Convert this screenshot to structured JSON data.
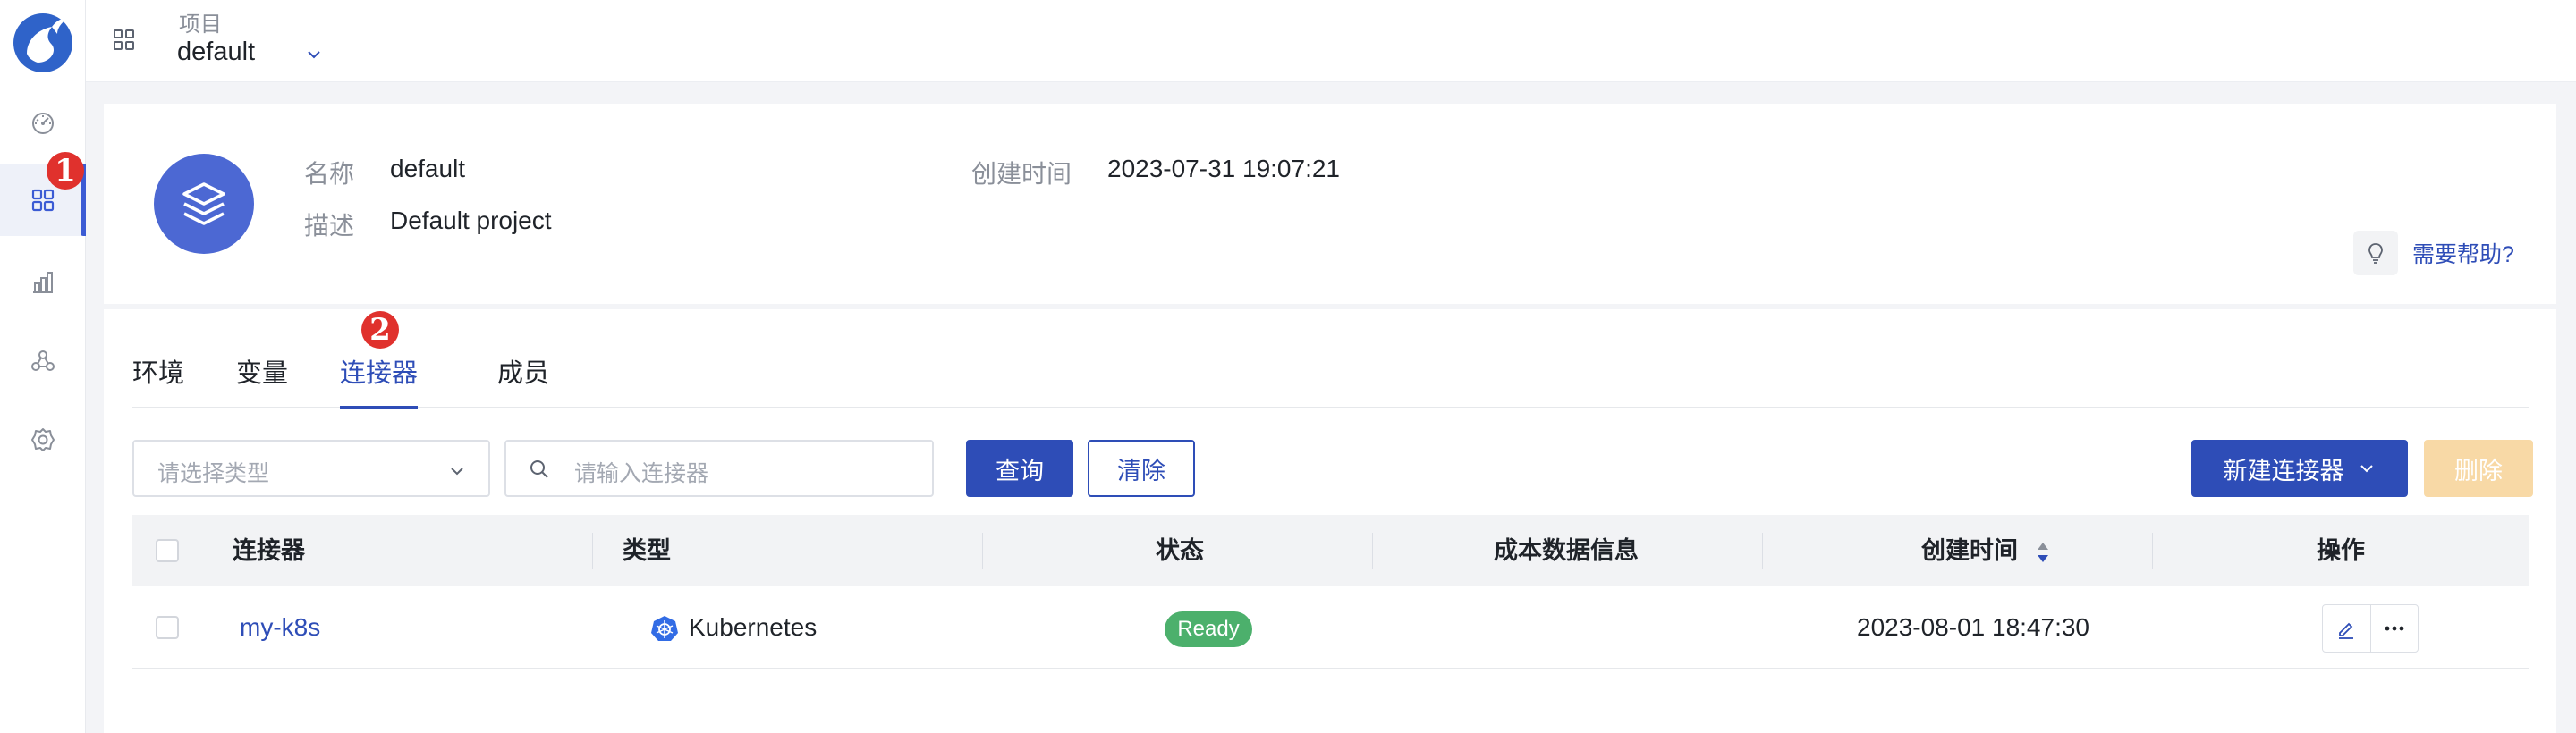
{
  "topbar": {
    "project_label": "项目",
    "project_value": "default"
  },
  "badges": {
    "one": "1",
    "two": "2"
  },
  "info": {
    "name_label": "名称",
    "name_value": "default",
    "desc_label": "描述",
    "desc_value": "Default project",
    "created_label": "创建时间",
    "created_value": "2023-07-31 19:07:21",
    "help_text": "需要帮助?"
  },
  "tabs": [
    {
      "label": "环境"
    },
    {
      "label": "变量"
    },
    {
      "label": "连接器",
      "active": true
    },
    {
      "label": "成员"
    }
  ],
  "filters": {
    "type_placeholder": "请选择类型",
    "search_placeholder": "请输入连接器",
    "query_button": "查询",
    "clear_button": "清除",
    "new_button": "新建连接器",
    "delete_button": "删除"
  },
  "table": {
    "columns": [
      "连接器",
      "类型",
      "状态",
      "成本数据信息",
      "创建时间",
      "操作"
    ],
    "rows": [
      {
        "name": "my-k8s",
        "type": "Kubernetes",
        "status": "Ready",
        "cost_info": "",
        "created": "2023-08-01 18:47:30"
      }
    ]
  },
  "colors": {
    "primary": "#2e4db7",
    "ready": "#4cb06c",
    "badge": "#e0312d",
    "disabled": "#f8d9a6"
  }
}
